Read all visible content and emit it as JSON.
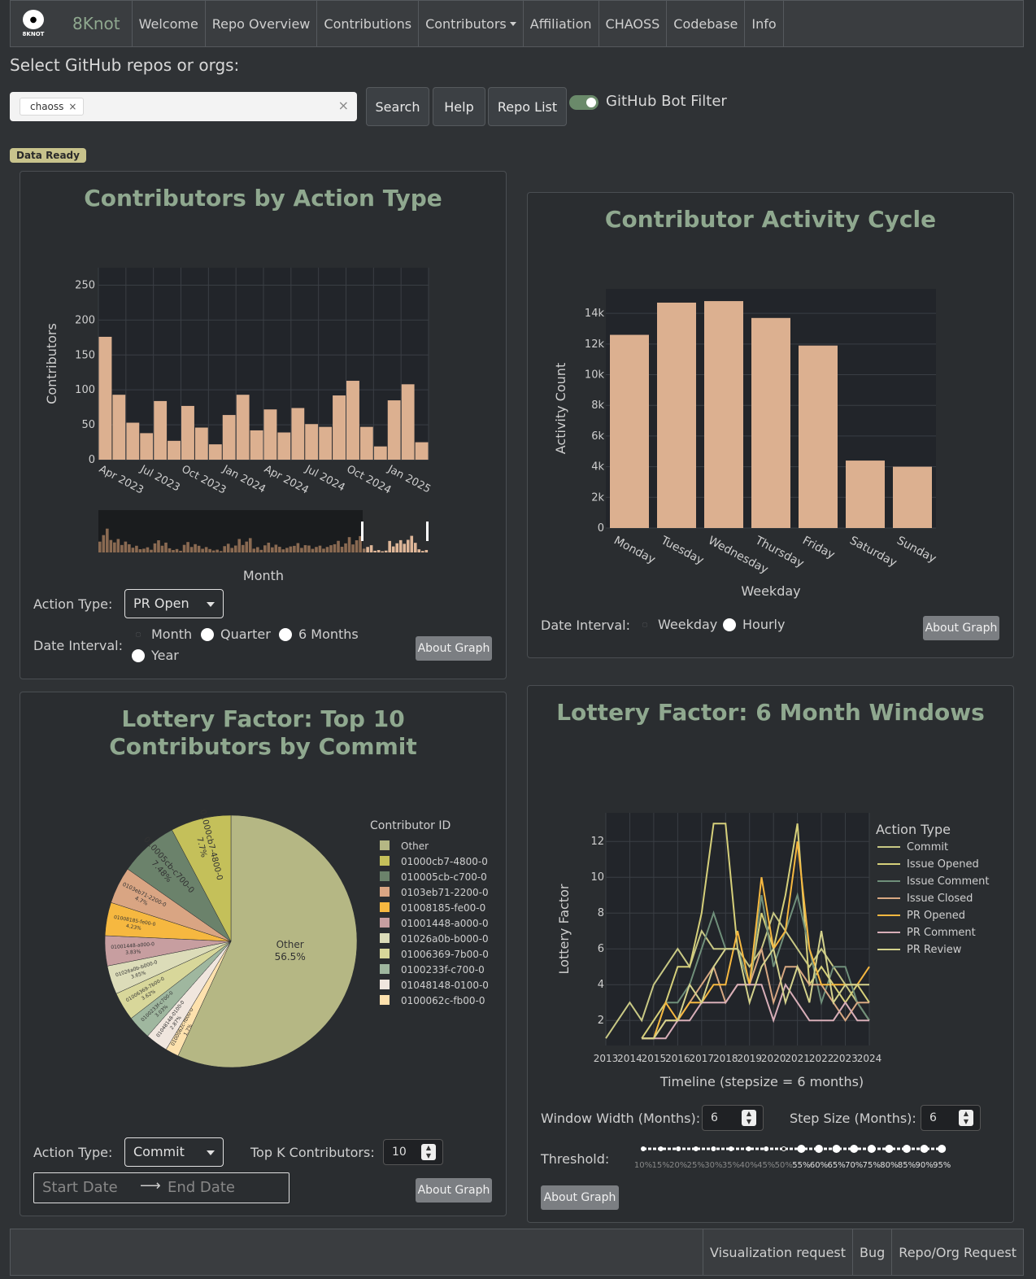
{
  "navbar": {
    "logo_text": "8KNOT",
    "brand": "8Knot",
    "items": [
      "Welcome",
      "Repo Overview",
      "Contributions",
      "Contributors",
      "Affiliation",
      "CHAOSS",
      "Codebase",
      "Info"
    ]
  },
  "search": {
    "label": "Select GitHub repos or orgs:",
    "chip": "chaoss",
    "buttons": [
      "Search",
      "Help",
      "Repo List"
    ],
    "bot_filter_label": "GitHub Bot Filter",
    "bot_filter_on": true,
    "status_badge": "Data Ready"
  },
  "card1": {
    "title": "Contributors by Action Type",
    "action_type_label": "Action Type:",
    "action_type_value": "PR Open",
    "date_interval_label": "Date Interval:",
    "date_options": [
      "Month",
      "Quarter",
      "6 Months",
      "Year"
    ],
    "date_selected": "Month",
    "about": "About Graph"
  },
  "card2": {
    "title": "Contributor Activity Cycle",
    "date_interval_label": "Date Interval:",
    "date_options": [
      "Weekday",
      "Hourly"
    ],
    "date_selected": "Weekday",
    "about": "About Graph"
  },
  "card3": {
    "title": "Lottery Factor: Top 10 Contributors by Commit",
    "action_type_label": "Action Type:",
    "action_type_value": "Commit",
    "topk_label": "Top K Contributors:",
    "topk_value": "10",
    "start_placeholder": "Start Date",
    "end_placeholder": "End Date",
    "about": "About Graph"
  },
  "card4": {
    "title": "Lottery Factor: 6 Month Windows",
    "window_label": "Window Width (Months):",
    "window_value": "6",
    "step_label": "Step Size (Months):",
    "step_value": "6",
    "threshold_label": "Threshold:",
    "threshold_marks": [
      "10%",
      "15%",
      "20%",
      "25%",
      "30%",
      "35%",
      "40%",
      "45%",
      "50%",
      "55%",
      "60%",
      "65%",
      "70%",
      "75%",
      "80%",
      "85%",
      "90%",
      "95%"
    ],
    "threshold_value": "50%",
    "about": "About Graph"
  },
  "footer": {
    "items": [
      "Visualization request",
      "Bug",
      "Repo/Org Request"
    ]
  },
  "colors": {
    "bar": "#dcb090",
    "title": "#8fa88f",
    "plot_bg": "#22252a"
  },
  "chart_data": [
    {
      "type": "bar",
      "xlabel": "Month",
      "ylabel": "Contributors",
      "ylim": [
        0,
        275
      ],
      "yticks": [
        0,
        50,
        100,
        150,
        200,
        250
      ],
      "xtick_labels": [
        "Apr 2023",
        "Jul 2023",
        "Oct 2023",
        "Jan 2024",
        "Apr 2024",
        "Jul 2024",
        "Oct 2024",
        "Jan 2025"
      ],
      "categories": [
        "Apr 2023",
        "May 2023",
        "Jun 2023",
        "Jul 2023",
        "Aug 2023",
        "Sep 2023",
        "Oct 2023",
        "Nov 2023",
        "Dec 2023",
        "Jan 2024",
        "Feb 2024",
        "Mar 2024",
        "Apr 2024",
        "May 2024",
        "Jun 2024",
        "Jul 2024",
        "Aug 2024",
        "Sep 2024",
        "Oct 2024",
        "Nov 2024",
        "Dec 2024",
        "Jan 2025",
        "Feb 2025"
      ],
      "values": [
        176,
        93,
        53,
        38,
        84,
        27,
        77,
        46,
        22,
        64,
        93,
        42,
        72,
        39,
        74,
        51,
        47,
        92,
        113,
        47,
        19,
        85,
        108,
        25
      ]
    },
    {
      "type": "bar",
      "xlabel": "Weekday",
      "ylabel": "Activity Count",
      "ylim": [
        0,
        15600
      ],
      "yticks": [
        0,
        2000,
        4000,
        6000,
        8000,
        10000,
        12000,
        14000
      ],
      "ytick_labels": [
        "0",
        "2k",
        "4k",
        "6k",
        "8k",
        "10k",
        "12k",
        "14k"
      ],
      "categories": [
        "Monday",
        "Tuesday",
        "Wednesday",
        "Thursday",
        "Friday",
        "Saturday",
        "Sunday"
      ],
      "values": [
        12600,
        14700,
        14800,
        13700,
        11900,
        4400,
        4000
      ]
    },
    {
      "type": "pie",
      "legend_title": "Contributor ID",
      "labels": [
        "Other",
        "01000cb7-4800-0",
        "010005cb-c700-0",
        "0103eb71-2200-0",
        "01008185-fe00-0",
        "01001448-a000-0",
        "01026a0b-b000-0",
        "01006369-7b00-0",
        "0100233f-c700-0",
        "01048148-0100-0",
        "0100062c-fb00-0"
      ],
      "values": [
        56.5,
        7.7,
        7.48,
        4.7,
        4.23,
        3.83,
        3.65,
        3.62,
        3.03,
        2.87,
        1.7
      ],
      "value_labels": [
        "56.5%",
        "7.7%",
        "7.48%",
        "4.7%",
        "4.23%",
        "3.83%",
        "3.65%",
        "3.62%",
        "3.03%",
        "2.87%",
        "1.7%"
      ],
      "colors": [
        "#b5b784",
        "#c4c05a",
        "#6b826b",
        "#d9a583",
        "#f6b840",
        "#c79ea0",
        "#dcdcb9",
        "#d8d79a",
        "#9fb79f",
        "#f0e6de",
        "#fde1ad"
      ]
    },
    {
      "type": "line",
      "xlabel": "Timeline (stepsize = 6 months)",
      "ylabel": "Lottery Factor",
      "legend_title": "Action Type",
      "x": [
        2013.0,
        2013.5,
        2014.0,
        2014.5,
        2015.0,
        2015.5,
        2016.0,
        2016.5,
        2017.0,
        2017.5,
        2018.0,
        2018.5,
        2019.0,
        2019.5,
        2020.0,
        2020.5,
        2021.0,
        2021.5,
        2022.0,
        2022.5,
        2023.0,
        2023.5,
        2024.0
      ],
      "xtick_labels": [
        "2013",
        "2014",
        "2015",
        "2016",
        "2017",
        "2018",
        "2019",
        "2020",
        "2021",
        "2022",
        "2023",
        "2024"
      ],
      "ylim": [
        0.6,
        13.6
      ],
      "yticks": [
        2,
        4,
        6,
        8,
        10,
        12
      ],
      "series": [
        {
          "name": "Commit",
          "color": "#c8c884",
          "values": [
            1,
            2,
            3,
            2,
            4,
            5,
            6,
            5,
            7,
            6,
            6,
            6,
            5,
            6,
            8,
            7,
            6,
            5,
            6,
            5,
            4,
            3,
            2
          ]
        },
        {
          "name": "Issue Opened",
          "color": "#d6d07a",
          "values": [
            null,
            null,
            null,
            1,
            2,
            3,
            5,
            5,
            8,
            13,
            13,
            6,
            4,
            8,
            6,
            9,
            13,
            4,
            5,
            4,
            3,
            4,
            3
          ]
        },
        {
          "name": "Issue Comment",
          "color": "#6f8f7a",
          "values": [
            null,
            null,
            null,
            1,
            1,
            3,
            3,
            4,
            6,
            8,
            6,
            6,
            4,
            9,
            5,
            7,
            9,
            6,
            3,
            5,
            5,
            3,
            2
          ]
        },
        {
          "name": "Issue Closed",
          "color": "#d8a882",
          "values": [
            null,
            null,
            null,
            1,
            1,
            2,
            2,
            3,
            4,
            5,
            3,
            4,
            4,
            6,
            3,
            5,
            5,
            4,
            4,
            3,
            2,
            3,
            3
          ]
        },
        {
          "name": "PR Opened",
          "color": "#f6b840",
          "values": [
            null,
            null,
            null,
            1,
            1,
            3,
            2,
            3,
            3,
            4,
            4,
            7,
            4,
            10,
            6,
            7,
            12,
            6,
            4,
            4,
            4,
            4,
            5
          ]
        },
        {
          "name": "PR Comment",
          "color": "#d8aeb8",
          "values": [
            null,
            null,
            null,
            1,
            1,
            1,
            2,
            2,
            3,
            3,
            3,
            4,
            4,
            4,
            2,
            4,
            3,
            2,
            2,
            2,
            3,
            2,
            2
          ]
        },
        {
          "name": "PR Review",
          "color": "#d4d28c",
          "values": [
            null,
            null,
            null,
            1,
            1,
            2,
            2,
            4,
            3,
            5,
            6,
            6,
            3,
            5,
            6,
            3,
            5,
            3,
            7,
            3,
            4,
            4,
            4
          ]
        }
      ]
    }
  ]
}
